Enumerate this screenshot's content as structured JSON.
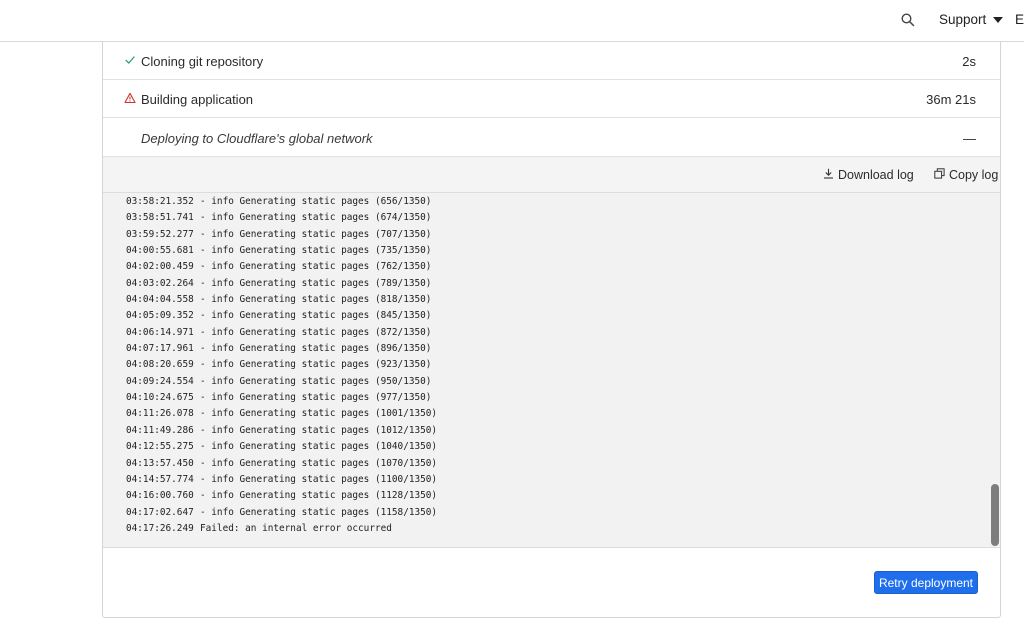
{
  "topbar": {
    "search_icon": "search-icon",
    "support_label": "Support",
    "account_label": "En"
  },
  "steps": [
    {
      "label": "Cloning git repository",
      "time": "2s",
      "status": "success",
      "icon": "check-icon"
    },
    {
      "label": "Building application",
      "time": "36m 21s",
      "status": "error",
      "icon": "warning-icon"
    },
    {
      "label": "Deploying to Cloudflare's global network",
      "time": "—",
      "status": "pending",
      "icon": "none"
    }
  ],
  "log_toolbar": {
    "download_label": "Download log",
    "copy_label": "Copy log"
  },
  "log": [
    {
      "ts": "03:58:21.352",
      "msg": "- info Generating static pages (656/1350)"
    },
    {
      "ts": "03:58:51.741",
      "msg": "- info Generating static pages (674/1350)"
    },
    {
      "ts": "03:59:52.277",
      "msg": "- info Generating static pages (707/1350)"
    },
    {
      "ts": "04:00:55.681",
      "msg": "- info Generating static pages (735/1350)"
    },
    {
      "ts": "04:02:00.459",
      "msg": "- info Generating static pages (762/1350)"
    },
    {
      "ts": "04:03:02.264",
      "msg": "- info Generating static pages (789/1350)"
    },
    {
      "ts": "04:04:04.558",
      "msg": "- info Generating static pages (818/1350)"
    },
    {
      "ts": "04:05:09.352",
      "msg": "- info Generating static pages (845/1350)"
    },
    {
      "ts": "04:06:14.971",
      "msg": "- info Generating static pages (872/1350)"
    },
    {
      "ts": "04:07:17.961",
      "msg": "- info Generating static pages (896/1350)"
    },
    {
      "ts": "04:08:20.659",
      "msg": "- info Generating static pages (923/1350)"
    },
    {
      "ts": "04:09:24.554",
      "msg": "- info Generating static pages (950/1350)"
    },
    {
      "ts": "04:10:24.675",
      "msg": "- info Generating static pages (977/1350)"
    },
    {
      "ts": "04:11:26.078",
      "msg": "- info Generating static pages (1001/1350)"
    },
    {
      "ts": "04:11:49.286",
      "msg": "- info Generating static pages (1012/1350)"
    },
    {
      "ts": "04:12:55.275",
      "msg": "- info Generating static pages (1040/1350)"
    },
    {
      "ts": "04:13:57.450",
      "msg": "- info Generating static pages (1070/1350)"
    },
    {
      "ts": "04:14:57.774",
      "msg": "- info Generating static pages (1100/1350)"
    },
    {
      "ts": "04:16:00.760",
      "msg": "- info Generating static pages (1128/1350)"
    },
    {
      "ts": "04:17:02.647",
      "msg": "- info Generating static pages (1158/1350)"
    },
    {
      "ts": "04:17:26.249",
      "msg": "Failed: an internal error occurred"
    }
  ],
  "actions": {
    "retry_label": "Retry deployment"
  },
  "colors": {
    "success": "#2e9e6b",
    "error": "#c9372c",
    "primary": "#1f6fed"
  }
}
